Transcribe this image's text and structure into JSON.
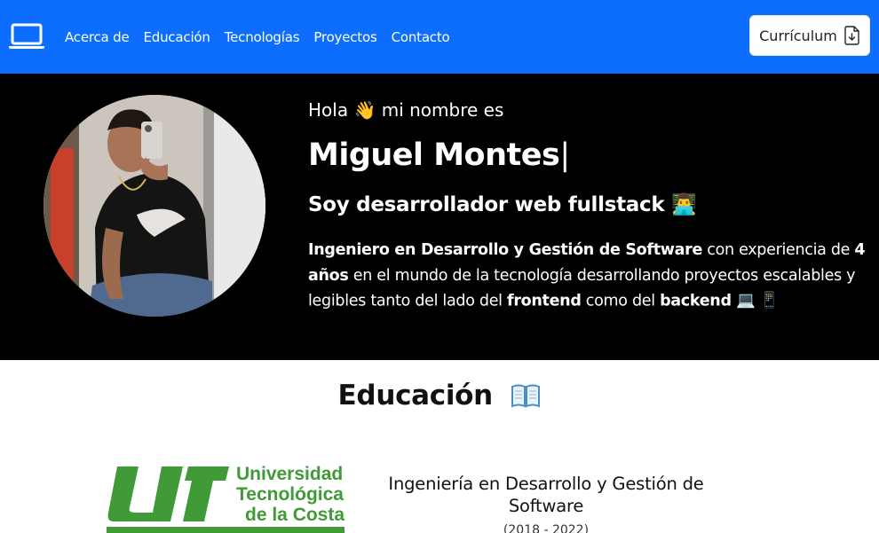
{
  "navbar": {
    "links": [
      "Acerca de",
      "Educación",
      "Tecnologías",
      "Proyectos",
      "Contacto"
    ],
    "cv_button": "Currículum",
    "brand_icon": "laptop-icon",
    "cv_icon": "file-download-icon",
    "background": "#0d6efd"
  },
  "hero": {
    "greeting_pre": "Hola",
    "greeting_post": "mi nombre es",
    "greeting_emoji": "👋",
    "name": "Miguel Montes",
    "cursor": "|",
    "role": "Soy desarrollador web fullstack",
    "role_emoji": "👨‍💻",
    "bio": {
      "p1_bold": "Ingeniero en Desarrollo y Gestión de Software",
      "p2": " con experiencia de ",
      "p3_bold": "4 años",
      "p4": " en el mundo de la tecnología desarrollando proyectos escalables y legibles tanto del lado del ",
      "p5_bold": "frontend",
      "p6": " como del ",
      "p7_bold": "backend",
      "end_emojis": "💻 📱"
    },
    "background": "#000000"
  },
  "education": {
    "title": "Educación",
    "title_icon": "book-icon",
    "school_logo": {
      "line1": "Universidad",
      "line2": "Tecnológica",
      "line3": "de la Costa",
      "mark": "UT",
      "color": "#3f9a37"
    },
    "degree": "Ingeniería en Desarrollo y Gestión de Software",
    "period": "(2018 - 2022)"
  }
}
